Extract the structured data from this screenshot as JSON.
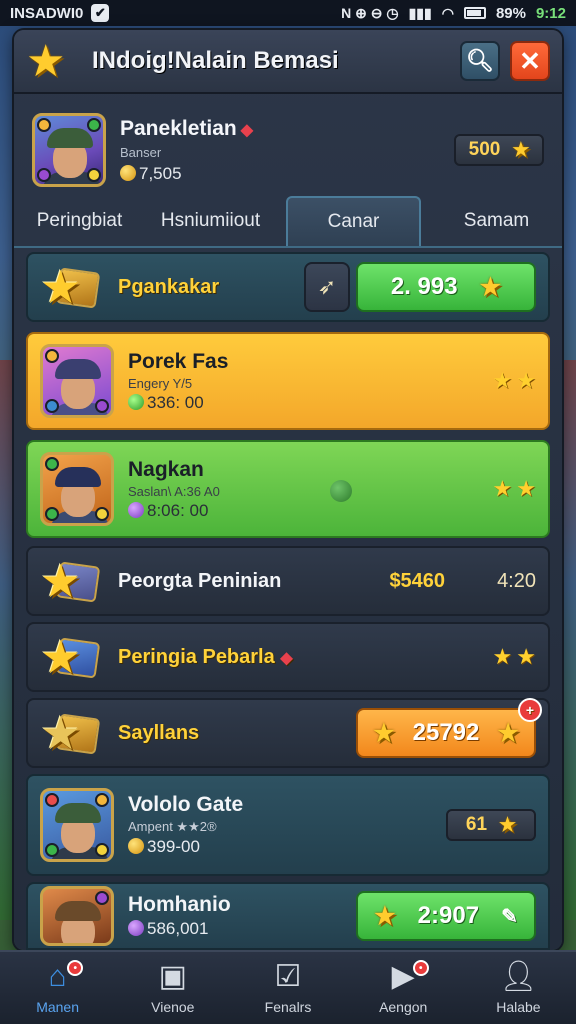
{
  "statusbar": {
    "carrier": "INSADWI0",
    "battery": "89%",
    "time": "9:12"
  },
  "header": {
    "title": "INdoig!Nalain Bemasi"
  },
  "profile": {
    "name": "Panekletian",
    "subtitle": "Banser",
    "coins": "7,505",
    "score": "500"
  },
  "tabs": [
    {
      "label": "Peringbiat"
    },
    {
      "label": "Hsniumiiout"
    },
    {
      "label": "Canar",
      "active": true
    },
    {
      "label": "Samam"
    }
  ],
  "rows": {
    "r1": {
      "label": "Pgankakar",
      "button_value": "2. 993"
    },
    "r2": {
      "name": "Porek Fas",
      "status": "Engery Y/5",
      "coins": "336: 00"
    },
    "r3": {
      "name": "Nagkan",
      "status": "Saslan\\ A:36 A0",
      "coins": "8:06: 00"
    },
    "r4": {
      "label": "Peorgta Peninian",
      "price": "$5460",
      "value": "4:20"
    },
    "r5": {
      "label": "Peringia Pebarla"
    },
    "r6": {
      "label": "Sayllans",
      "button_value": "25792"
    },
    "r7": {
      "name": "Vololo Gate",
      "status": "Ampent ★★2®",
      "coins": "399-00",
      "score": "61"
    },
    "r8": {
      "name": "Homhanio",
      "coins": "586,001",
      "button_value": "2:907"
    }
  },
  "bottomnav": [
    {
      "label": "Manen",
      "active": true
    },
    {
      "label": "Vienoe"
    },
    {
      "label": "Fenalrs"
    },
    {
      "label": "Aengon"
    },
    {
      "label": "Halabe"
    }
  ]
}
